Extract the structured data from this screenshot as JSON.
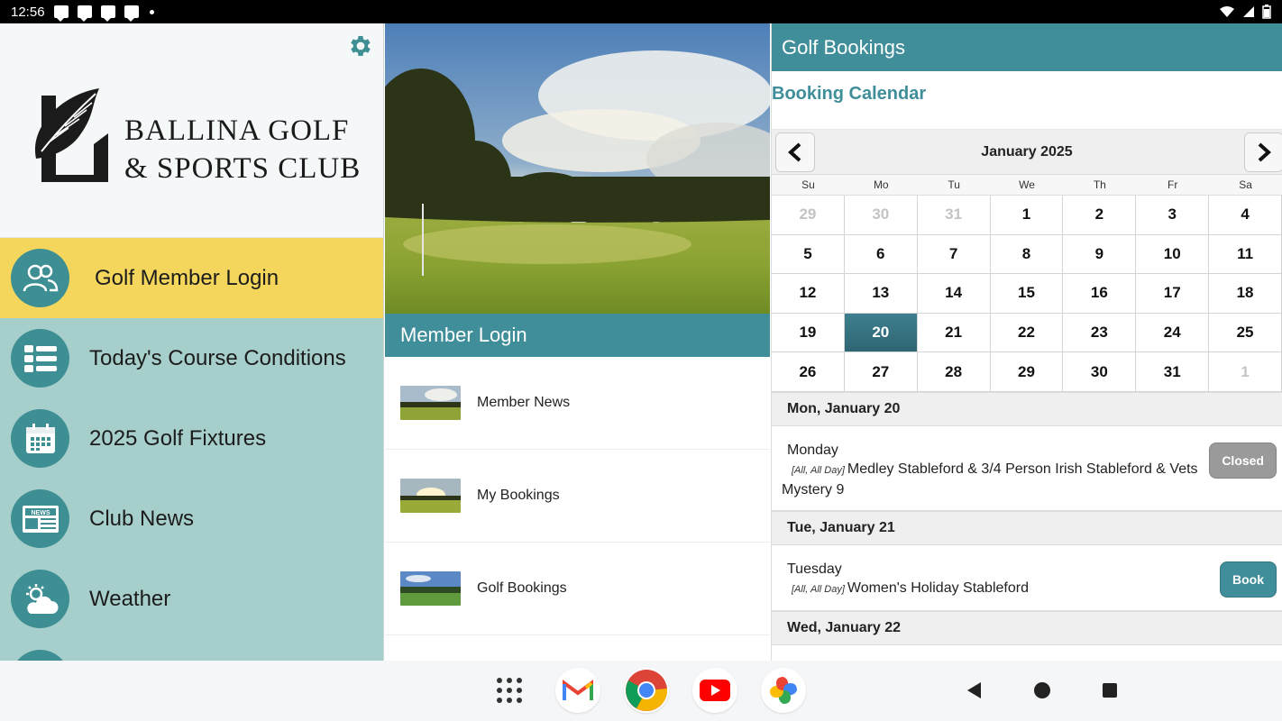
{
  "status_bar": {
    "time": "12:56"
  },
  "club": {
    "name_line1": "BALLINA GOLF",
    "name_line2": "& SPORTS CLUB"
  },
  "menu": [
    {
      "label": "Golf Member Login",
      "icon": "members-icon",
      "active": true
    },
    {
      "label": "Today's Course Conditions",
      "icon": "list-icon"
    },
    {
      "label": "2025 Golf Fixtures",
      "icon": "calendar-icon"
    },
    {
      "label": "Club News",
      "icon": "newspaper-icon"
    },
    {
      "label": "Weather",
      "icon": "weather-icon"
    }
  ],
  "member_login": {
    "title": "Member Login",
    "items": [
      {
        "label": "Member News"
      },
      {
        "label": "My Bookings"
      },
      {
        "label": "Golf Bookings"
      }
    ]
  },
  "bookings": {
    "header": "Golf Bookings",
    "calendar_title": "Booking Calendar",
    "month": "January 2025",
    "weekdays": [
      "Su",
      "Mo",
      "Tu",
      "We",
      "Th",
      "Fr",
      "Sa"
    ],
    "days": [
      {
        "d": "29",
        "m": true
      },
      {
        "d": "30",
        "m": true
      },
      {
        "d": "31",
        "m": true
      },
      {
        "d": "1"
      },
      {
        "d": "2"
      },
      {
        "d": "3"
      },
      {
        "d": "4"
      },
      {
        "d": "5"
      },
      {
        "d": "6"
      },
      {
        "d": "7"
      },
      {
        "d": "8"
      },
      {
        "d": "9"
      },
      {
        "d": "10"
      },
      {
        "d": "11"
      },
      {
        "d": "12"
      },
      {
        "d": "13"
      },
      {
        "d": "14"
      },
      {
        "d": "15"
      },
      {
        "d": "16"
      },
      {
        "d": "17"
      },
      {
        "d": "18"
      },
      {
        "d": "19"
      },
      {
        "d": "20",
        "t": true
      },
      {
        "d": "21"
      },
      {
        "d": "22"
      },
      {
        "d": "23"
      },
      {
        "d": "24"
      },
      {
        "d": "25"
      },
      {
        "d": "26"
      },
      {
        "d": "27"
      },
      {
        "d": "28"
      },
      {
        "d": "29"
      },
      {
        "d": "30"
      },
      {
        "d": "31"
      },
      {
        "d": "1",
        "m": true
      }
    ],
    "schedule": [
      {
        "date": "Mon, January 20",
        "weekday": "Monday",
        "tag": "[All, All Day]",
        "event": "Medley Stableford & 3/4 Person Irish Stableford & Vets Mystery 9",
        "status": "Closed"
      },
      {
        "date": "Tue, January 21",
        "weekday": "Tuesday",
        "tag": "[All, All Day]",
        "event": "Women's Holiday Stableford",
        "status": "Book"
      },
      {
        "date": "Wed, January 22"
      }
    ]
  },
  "colors": {
    "teal": "#3f8e99",
    "menu_bg": "#a6cfcb",
    "active": "#f4d65c"
  }
}
